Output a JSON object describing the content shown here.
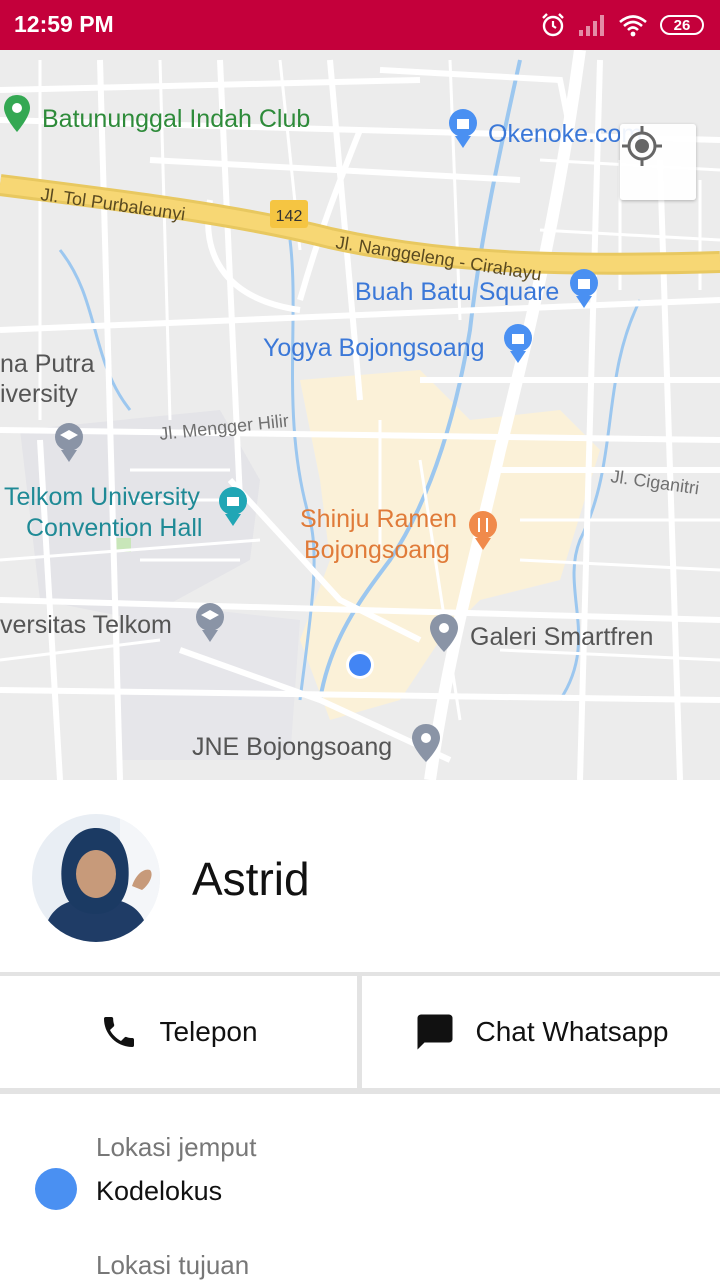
{
  "status_bar": {
    "time": "12:59 PM",
    "battery": "26"
  },
  "map": {
    "labels": {
      "batununggal": "Batununggal Indah Club",
      "okenoke": "Okenoke.com",
      "tol_purbaleunyi": "Jl. Tol Purbaleunyi",
      "route_142": "142",
      "nanggeleng": "Jl. Nanggeleng - Cirahayu",
      "buah_batu": "Buah Batu Square",
      "yogya": "Yogya Bojongsoang",
      "putra_university_1": "na Putra",
      "putra_university_2": "iversity",
      "menger_hilir": "Jl. Mengger Hilir",
      "ciganitri": "Jl. Ciganitri",
      "telkom_convention_1": "Telkom University",
      "telkom_convention_2": "Convention Hall",
      "shinju_1": "Shinju Ramen",
      "shinju_2": "Bojongsoang",
      "universitas_telkom": "versitas Telkom",
      "galeri": "Galeri Smartfren",
      "jne": "JNE Bojongsoang"
    }
  },
  "driver": {
    "name": "Astrid"
  },
  "actions": {
    "call_label": "Telepon",
    "whatsapp_label": "Chat Whatsapp"
  },
  "trip": {
    "pickup_label": "Lokasi jemput",
    "pickup_value": "Kodelokus",
    "destination_label": "Lokasi tujuan"
  },
  "colors": {
    "status_bar": "#c4003b",
    "pickup_dot": "#4a90f2",
    "highway": "#f7d774"
  }
}
